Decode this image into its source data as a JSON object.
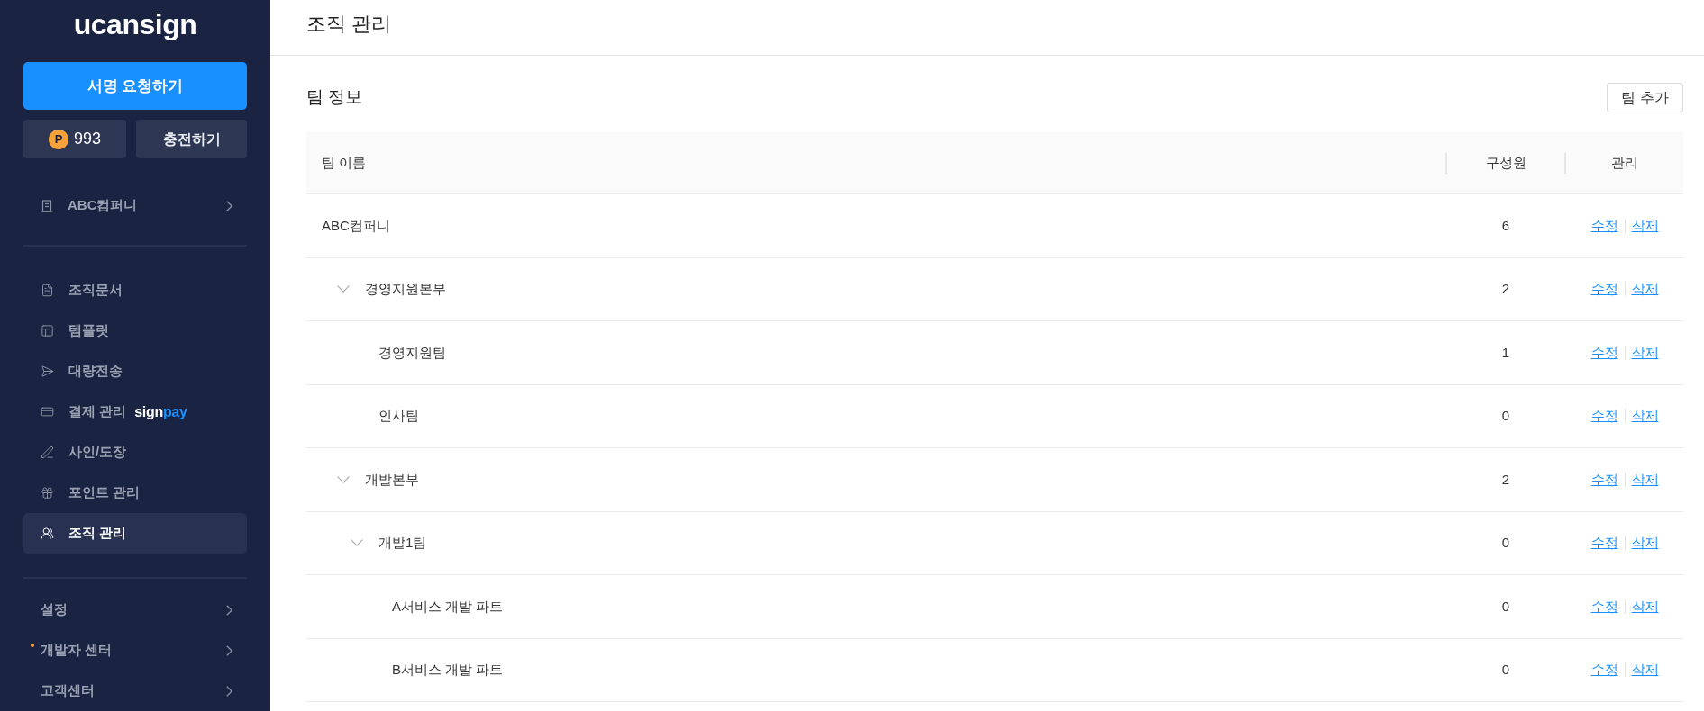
{
  "sidebar": {
    "logo": "ucansign",
    "request_button": "서명 요청하기",
    "points": {
      "symbol": "P",
      "value": "993"
    },
    "charge_button": "충전하기",
    "company": "ABC컴퍼니",
    "menu": [
      {
        "label": "조직문서",
        "selected": false
      },
      {
        "label": "템플릿",
        "selected": false
      },
      {
        "label": "대량전송",
        "selected": false
      },
      {
        "label": "결제 관리",
        "selected": false,
        "brand": [
          "sign",
          "pay"
        ]
      },
      {
        "label": "사인/도장",
        "selected": false
      },
      {
        "label": "포인트 관리",
        "selected": false
      },
      {
        "label": "조직 관리",
        "selected": true
      }
    ],
    "footer_menu": [
      {
        "label": "설정",
        "new": false
      },
      {
        "label": "개발자 센터",
        "new": true
      },
      {
        "label": "고객센터",
        "new": false
      }
    ]
  },
  "header": {
    "title": "조직 관리"
  },
  "section": {
    "title": "팀 정보",
    "add_button": "팀 추가"
  },
  "table": {
    "columns": [
      "팀 이름",
      "구성원",
      "관리"
    ],
    "rows": [
      {
        "name": "ABC컴퍼니",
        "members": "6",
        "actions": [
          "수정",
          "삭제"
        ],
        "children": [
          {
            "name": "경영지원본부",
            "members": "2",
            "actions": [
              "수정",
              "삭제"
            ],
            "expanded": true,
            "children": [
              {
                "name": "경영지원팀",
                "members": "1",
                "actions": [
                  "수정",
                  "삭제"
                ]
              },
              {
                "name": "인사팀",
                "members": "0",
                "actions": [
                  "수정",
                  "삭제"
                ]
              }
            ]
          },
          {
            "name": "개발본부",
            "members": "2",
            "actions": [
              "수정",
              "삭제"
            ],
            "expanded": true,
            "children": [
              {
                "name": "개발1팀",
                "members": "0",
                "actions": [
                  "수정",
                  "삭제"
                ],
                "expanded": true,
                "children": [
                  {
                    "name": "A서비스 개발 파트",
                    "members": "0",
                    "actions": [
                      "수정",
                      "삭제"
                    ]
                  },
                  {
                    "name": "B서비스 개발 파트",
                    "members": "0",
                    "actions": [
                      "수정",
                      "삭제"
                    ]
                  }
                ]
              }
            ]
          }
        ]
      }
    ]
  }
}
